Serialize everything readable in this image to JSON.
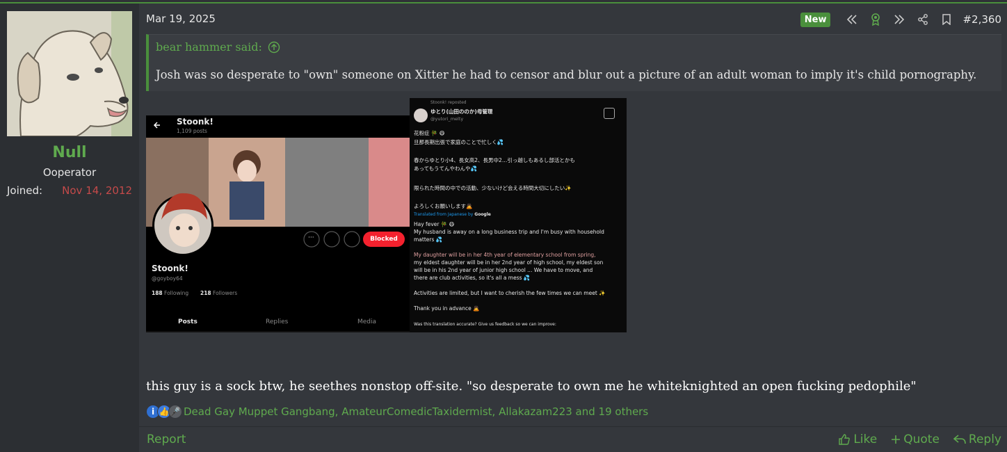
{
  "post": {
    "date": "Mar 19, 2025",
    "new_badge": "New",
    "post_number": "#2,360"
  },
  "user": {
    "name": "Null",
    "title": "Ooperator",
    "joined_label": "Joined:",
    "joined_value": "Nov 14, 2012"
  },
  "quote": {
    "author": "bear hammer said:",
    "text": "Josh was so desperate to \"own\" someone on Xitter he had to censor and blur out a picture of an adult woman to imply it's child pornography."
  },
  "embed_profile": {
    "name": "Stoonk!",
    "posts": "1,109 posts",
    "handle": "@goyboy64",
    "following_count": "188",
    "following_label": "Following",
    "followers_count": "218",
    "followers_label": "Followers",
    "blocked_label": "Blocked",
    "tabs": [
      "Posts",
      "Replies",
      "Media"
    ]
  },
  "embed_tweet": {
    "reposted": "Stoonk! reposted",
    "display_name": "ゆとり(山田ののか)母管理",
    "handle": "@yutori_melty",
    "jp_lines": [
      "花粉症 🎋 😷",
      "旦那長期出張で家庭のことで忙しく💦",
      "春からゆとり小4、長女高2、長男中2…引っ越しもあるし部活とかも",
      "あってもうてんやわんや💦",
      "限られた時間の中での活動、少ないけど会える時間大切にしたい✨",
      "よろしくお願いします🙇"
    ],
    "translated_from": "Translated from Japanese by",
    "translator": "Google",
    "en_lines": [
      "Hay fever 🎋 😷",
      "My husband is away on a long business trip and I'm busy with household",
      "matters 💦",
      "My daughter will be in her 4th year of elementary school from spring,",
      "my eldest daughter will be in her 2nd year of high school, my eldest son",
      "will be in his 2nd year of junior high school ... We have to move, and",
      "there are club activities, so it's all a mess 💦",
      "Activities are limited, but I want to cherish the few times we can meet ✨",
      "Thank you in advance 🙇",
      "Was this translation accurate? Give us feedback so we can improve:"
    ]
  },
  "body": {
    "text": "this guy is a sock btw, he seethes nonstop off-site. \"so desperate to own me he whiteknighted an open fucking pedophile\""
  },
  "reactions": {
    "names": "Dead Gay Muppet Gangbang, AmateurComedicTaxidermist, Allakazam223 and 19 others"
  },
  "footer": {
    "report": "Report",
    "like": "Like",
    "quote": "Quote",
    "reply": "Reply"
  },
  "colors": {
    "accent_green": "#5faa4e",
    "badge_green": "#4a8f3c",
    "joined_red": "#c44a4a",
    "blocked_red": "#f4212e"
  }
}
